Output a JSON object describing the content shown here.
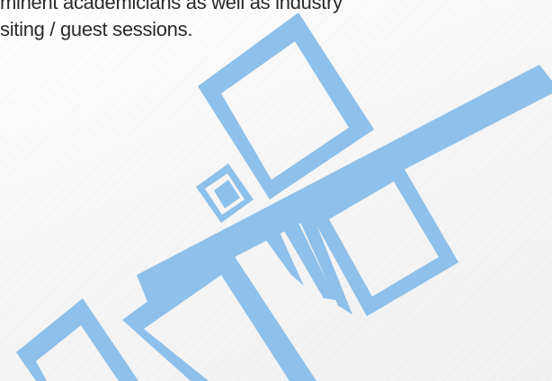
{
  "text": {
    "line1": "minent academicians as well as industry",
    "line2": "siting / guest sessions."
  },
  "graphic": {
    "name": "geometric-squares-graphic",
    "color": "#8dc0ea"
  }
}
